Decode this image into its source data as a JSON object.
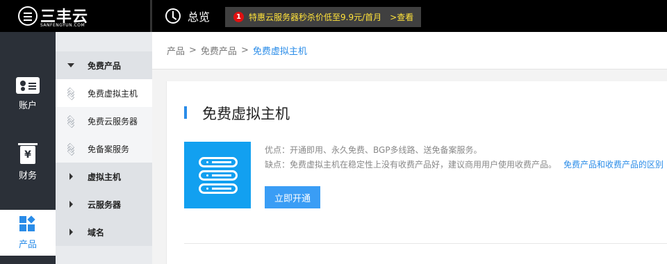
{
  "brand": {
    "name": "三丰云",
    "domain": "SANFENGYUN.COM"
  },
  "header": {
    "overview_label": "总览",
    "promo": {
      "badge": "1",
      "text": "特惠云服务器秒杀价低至9.9元/首月",
      "link": ">查看"
    }
  },
  "sidebar": {
    "items": [
      {
        "label": "账户",
        "icon": "account-card-icon"
      },
      {
        "label": "财务",
        "icon": "yen-document-icon"
      },
      {
        "label": "产品",
        "icon": "product-blocks-icon",
        "active": true
      }
    ]
  },
  "subnav": {
    "groups": [
      {
        "label": "免费产品",
        "expanded": true,
        "children": [
          {
            "label": "免费虚拟主机",
            "active": true
          },
          {
            "label": "免费云服务器"
          },
          {
            "label": "免备案服务"
          }
        ]
      },
      {
        "label": "虚拟主机",
        "expanded": false
      },
      {
        "label": "云服务器",
        "expanded": false
      },
      {
        "label": "域名",
        "expanded": false
      }
    ]
  },
  "breadcrumb": {
    "items": [
      "产品",
      "免费产品",
      "免费虚拟主机"
    ],
    "separator": ">"
  },
  "card": {
    "title": "免费虚拟主机",
    "pros": "优点：开通即用、永久免费、BGP多线路、送免备案服务。",
    "cons": "缺点：免费虚拟主机在稳定性上没有收费产品好，建议商用用户使用收费产品。",
    "cons_link": "免费产品和收费产品的区别",
    "button_label": "立即开通"
  },
  "colors": {
    "accent": "#2a8ce8",
    "sidebar_bg": "#2b3038",
    "promo_text": "#ffe23a",
    "tile": "#12a0f0"
  }
}
